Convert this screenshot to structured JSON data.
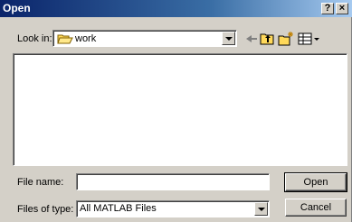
{
  "window": {
    "title": "Open",
    "help_label": "?",
    "close_label": "×"
  },
  "lookin": {
    "label": "Look in:",
    "value": "work"
  },
  "toolbar": {
    "icons": [
      "back-arrow-icon",
      "up-folder-icon",
      "new-folder-icon",
      "view-menu-icon"
    ]
  },
  "filename": {
    "label": "File name:",
    "value": ""
  },
  "filetype": {
    "label": "Files of type:",
    "value": "All MATLAB Files"
  },
  "buttons": {
    "open": "Open",
    "cancel": "Cancel"
  },
  "colors": {
    "title_start": "#0a246a",
    "title_end": "#a6caf0",
    "face": "#d4d0c8",
    "folder": "#ffd95a"
  }
}
